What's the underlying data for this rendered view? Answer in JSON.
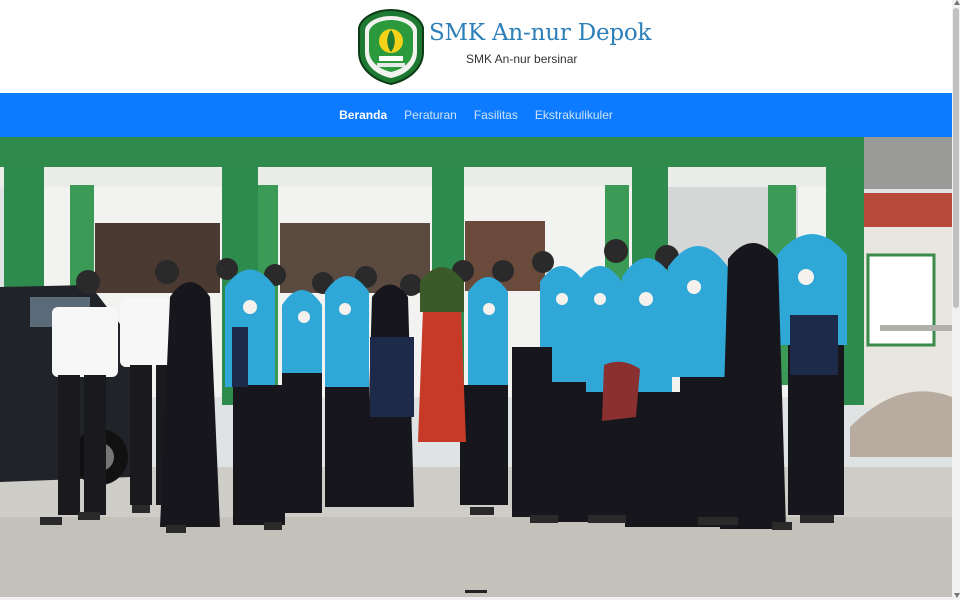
{
  "header": {
    "title": "SMK An-nur Depok",
    "tagline": "SMK An-nur bersinar",
    "logo_icon": "school-crest-logo"
  },
  "nav": {
    "items": [
      {
        "label": "Beranda",
        "active": true
      },
      {
        "label": "Peraturan",
        "active": false
      },
      {
        "label": "Fasilitas",
        "active": false
      },
      {
        "label": "Ekstrakulikuler",
        "active": false
      }
    ]
  },
  "hero": {
    "image_icon": "group-photo-image"
  },
  "colors": {
    "navbar": "#0d7bff",
    "title": "#2c7fb8",
    "building_green": "#2e8b4e",
    "hijab_blue": "#2fa8d8"
  }
}
